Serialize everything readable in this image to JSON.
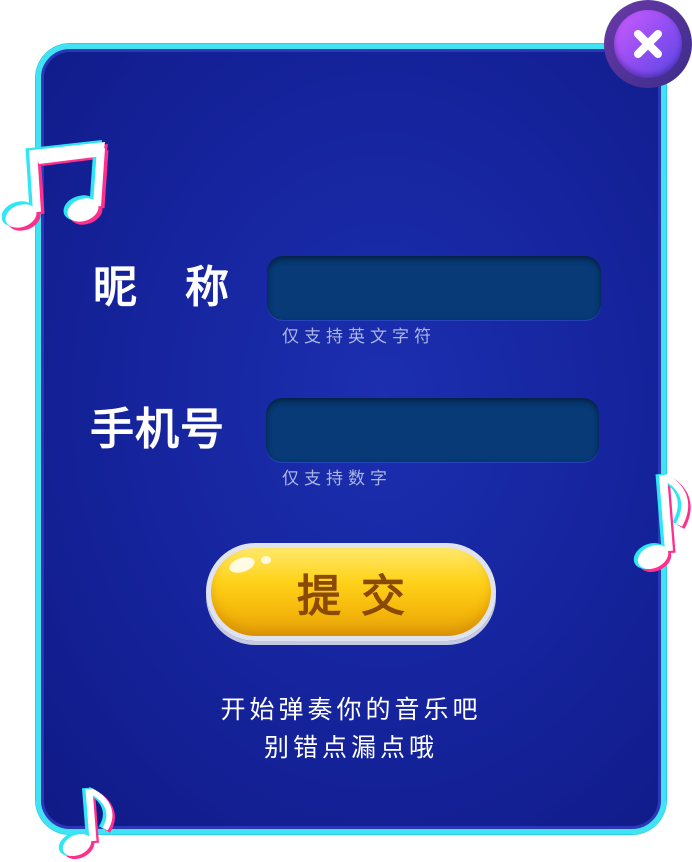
{
  "form": {
    "nickname_label": "昵称",
    "nickname_value": "",
    "nickname_hint": "仅支持英文字符",
    "phone_label": "手机号",
    "phone_value": "",
    "phone_hint": "仅支持数字",
    "submit_label": "提交"
  },
  "tip": {
    "line1": "开始弹奏你的音乐吧",
    "line2": "别错点漏点哦"
  },
  "colors": {
    "panel_bg": "#15239b",
    "panel_border": "#3fe3f4",
    "field_bg": "#073a76",
    "submit_yellow": "#ffd21a",
    "submit_text": "#8a4a05",
    "close_purple": "#b857ff"
  },
  "icons": {
    "close": "close-icon",
    "decor_notes": [
      "music-note-icon",
      "music-note-icon",
      "music-note-icon"
    ]
  }
}
